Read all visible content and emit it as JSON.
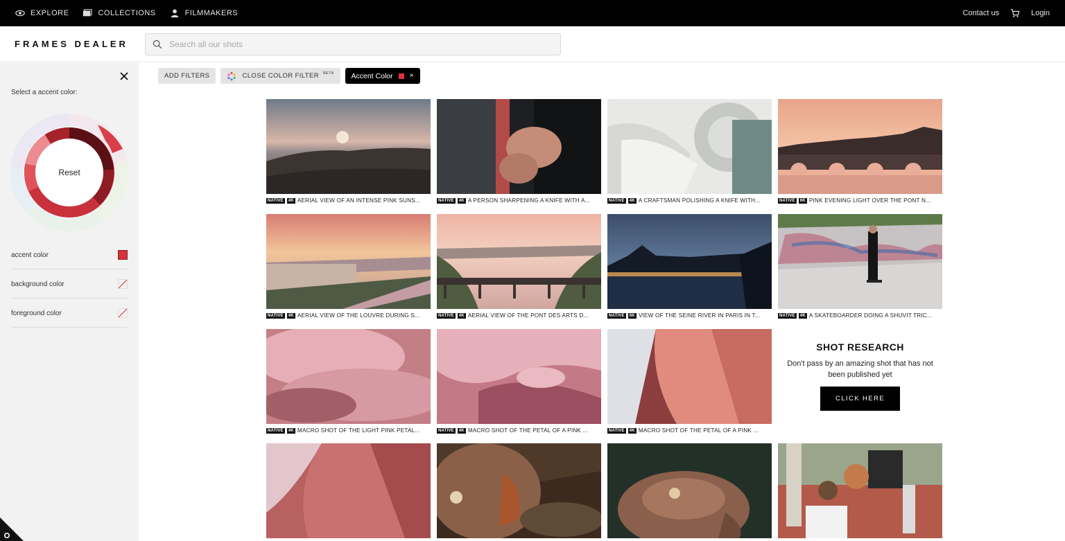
{
  "topnav": {
    "explore": "EXPLORE",
    "collections": "COLLECTIONS",
    "filmmakers": "FILMMAKERS",
    "contact": "Contact us",
    "login": "Login"
  },
  "header": {
    "logo": "FRAMES DEALER",
    "search_placeholder": "Search all our shots"
  },
  "sidebar": {
    "title": "Select a accent color:",
    "wheel_label": "Reset",
    "rows": [
      {
        "label": "accent color",
        "state": "filled",
        "color": "#d6343d"
      },
      {
        "label": "background color",
        "state": "empty"
      },
      {
        "label": "foreground color",
        "state": "empty"
      }
    ]
  },
  "filters": {
    "add": "ADD FILTERS",
    "color_filter": "CLOSE COLOR FILTER",
    "beta": "BETA",
    "accent_chip": "Accent Color",
    "accent_chip_close": "×"
  },
  "shots": [
    {
      "badge1": "NATIVE",
      "badge2": "4K",
      "title": "AERIAL VIEW OF AN INTENSE PINK SUNS..."
    },
    {
      "badge1": "NATIVE",
      "badge2": "4K",
      "title": "A PERSON SHARPENING A KNIFE WITH A..."
    },
    {
      "badge1": "NATIVE",
      "badge2": "4K",
      "title": "A CRAFTSMAN POLISHING A KNIFE WITH..."
    },
    {
      "badge1": "NATIVE",
      "badge2": "6K",
      "title": "PINK EVENING LIGHT OVER THE PONT N..."
    },
    {
      "badge1": "NATIVE",
      "badge2": "4K",
      "title": "AERIAL VIEW OF THE LOUVRE DURING S..."
    },
    {
      "badge1": "NATIVE",
      "badge2": "4K",
      "title": "AERIAL VIEW OF THE PONT DES ARTS D..."
    },
    {
      "badge1": "NATIVE",
      "badge2": "6K",
      "title": "VIEW OF THE SEINE RIVER IN PARIS IN T..."
    },
    {
      "badge1": "NATIVE",
      "badge2": "4K",
      "title": "A SKATEBOARDER DOING A SHUVIT TRIC..."
    },
    {
      "badge1": "NATIVE",
      "badge2": "4K",
      "title": "MACRO SHOT OF THE LIGHT PINK PETAL..."
    },
    {
      "badge1": "NATIVE",
      "badge2": "4K",
      "title": "MACRO SHOT OF THE PETAL OF A PINK ..."
    },
    {
      "badge1": "NATIVE",
      "badge2": "4K",
      "title": "MACRO SHOT OF THE PETAL OF A PINK ..."
    }
  ],
  "research": {
    "title": "SHOT RESEARCH",
    "text": "Don't pass by an amazing shot that has not been published yet",
    "button": "CLICK HERE"
  },
  "colors": {
    "accent": "#d6343d",
    "topbar": "#000000",
    "sidebar_bg": "#f2f2f2"
  }
}
